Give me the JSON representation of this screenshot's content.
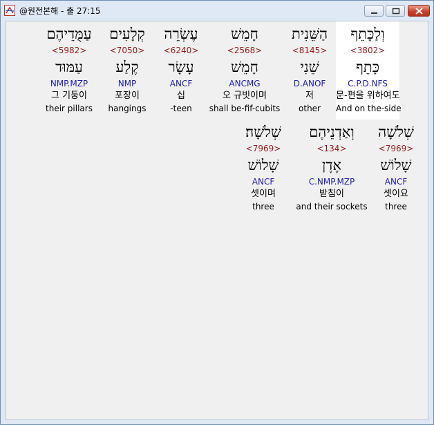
{
  "window": {
    "title": "@원전본해 - 출 27:15"
  },
  "words_line1": [
    {
      "hebrew": "וְלַכָּתֵף",
      "strong": "<3802>",
      "lemma": "כָּתֵף",
      "morph": "C.P.D.NFS",
      "korean": "문-편을 위하여도",
      "english": "And on the-side",
      "selected": true
    },
    {
      "hebrew": "הַשֵּׁנִית",
      "strong": "<8145>",
      "lemma": "שֵׁנִי",
      "morph": "D.ANOF",
      "korean": "저",
      "english": "other",
      "selected": false
    },
    {
      "hebrew": "חָמֵשׁ",
      "strong": "<2568>",
      "lemma": "חָמֵשׁ",
      "morph": "ANCMG",
      "korean": "오 규빗이며",
      "english": "shall be-fif-cubits",
      "selected": false
    },
    {
      "hebrew": "עֶשְׂרֵה",
      "strong": "<6240>",
      "lemma": "עָשָׂר",
      "morph": "ANCF",
      "korean": "십",
      "english": "-teen",
      "selected": false
    },
    {
      "hebrew": "קְלָעִים",
      "strong": "<7050>",
      "lemma": "קֶלַע",
      "morph": "NMP",
      "korean": "포장이",
      "english": "hangings",
      "selected": false
    },
    {
      "hebrew": "עַמֻּדֵיהֶם",
      "strong": "<5982>",
      "lemma": "עַמּוּד",
      "morph": "NMP.MZP",
      "korean": "그 기둥이",
      "english": "their pillars",
      "selected": false
    }
  ],
  "words_line2": [
    {
      "hebrew": "שְׁלֹשָׁה",
      "strong": "<7969>",
      "lemma": "שָׁלוֹשׁ",
      "morph": "ANCF",
      "korean": "셋이요",
      "english": "three"
    },
    {
      "hebrew": "וְאַדְנֵיהֶם",
      "strong": "<134>",
      "lemma": "אֶדֶן",
      "morph": "C.NMP.MZP",
      "korean": "받침이",
      "english": "and their sockets"
    },
    {
      "hebrew": "שְׁלֹשָׁה׃",
      "strong": "<7969>",
      "lemma": "שָׁלוֹשׁ",
      "morph": "ANCF",
      "korean": "셋이며",
      "english": "three"
    }
  ]
}
